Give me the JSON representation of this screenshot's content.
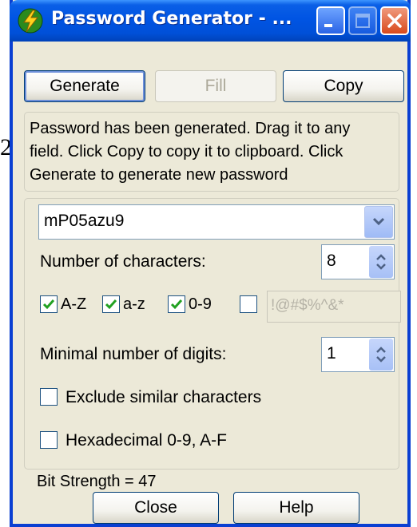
{
  "stray_char": "2",
  "window": {
    "title": "Password Generator - ...",
    "controls": {
      "minimize": "minimize-icon",
      "maximize": "maximize-icon",
      "close": "close-icon"
    }
  },
  "toolbar": {
    "generate_label": "Generate",
    "fill_label": "Fill",
    "copy_label": "Copy"
  },
  "info": {
    "line1": "Password has been generated. Drag it to any",
    "line2": "field. Click Copy to copy it to clipboard. Click",
    "line3": "Generate to generate new password"
  },
  "password": {
    "value": "mP05azu9"
  },
  "num_chars": {
    "label": "Number of characters:",
    "value": "8"
  },
  "charsets": {
    "upper": {
      "label": "A-Z",
      "checked": true
    },
    "lower": {
      "label": "a-z",
      "checked": true
    },
    "digits": {
      "label": "0-9",
      "checked": true
    },
    "special": {
      "value": "!@#$%^&*",
      "checked": false
    }
  },
  "min_digits": {
    "label": "Minimal number of digits:",
    "value": "1"
  },
  "options": {
    "exclude_similar": {
      "label": "Exclude similar characters",
      "checked": false
    },
    "hexadecimal": {
      "label": "Hexadecimal 0-9, A-F",
      "checked": false
    }
  },
  "bit_strength": "Bit Strength = 47",
  "footer": {
    "close_label": "Close",
    "help_label": "Help"
  },
  "colors": {
    "titlebar": "#0054e3",
    "face": "#ece9d8",
    "check": "#21a121"
  }
}
